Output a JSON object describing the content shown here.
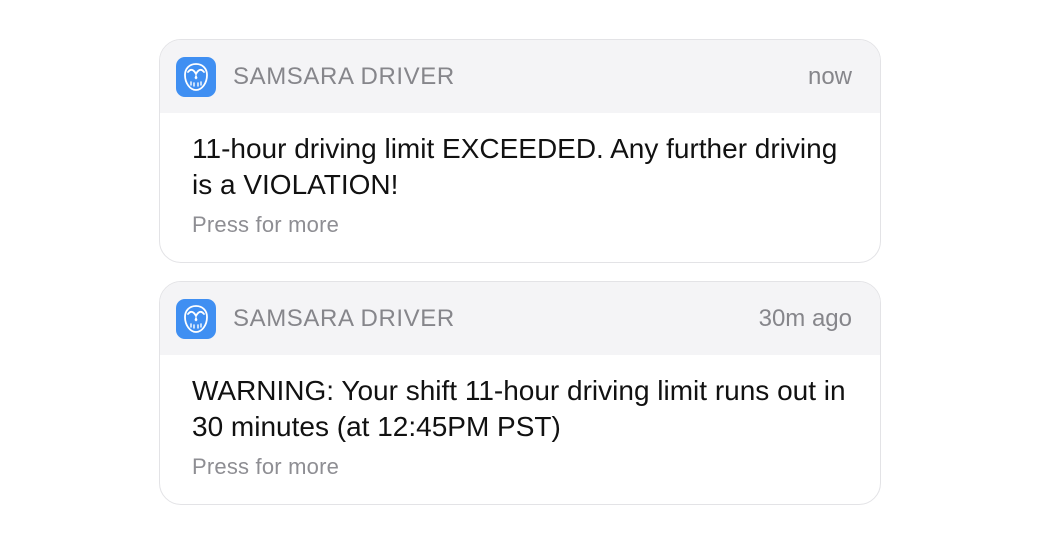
{
  "colors": {
    "icon_background": "#3f8ff2",
    "header_background": "#f4f4f6",
    "secondary_text": "#86868b",
    "primary_text": "#111111"
  },
  "notifications": [
    {
      "app_icon": "owl-app-icon",
      "app_name": "SAMSARA DRIVER",
      "time": "now",
      "message": "11-hour driving limit EXCEEDED. Any further driving is a VIOLATION!",
      "action": "Press for more"
    },
    {
      "app_icon": "owl-app-icon",
      "app_name": "SAMSARA DRIVER",
      "time": "30m ago",
      "message": "WARNING: Your shift 11-hour driving limit runs out in 30 minutes (at 12:45PM PST)",
      "action": "Press for more"
    }
  ]
}
